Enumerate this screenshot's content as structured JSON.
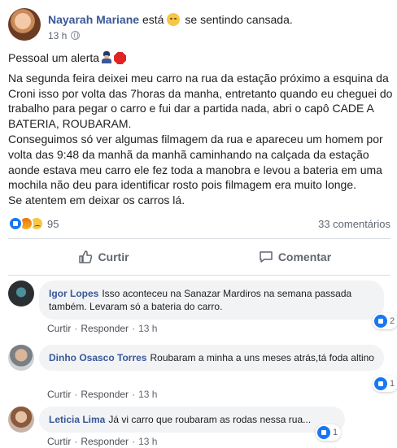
{
  "post": {
    "author": "Nayarah Mariane",
    "feeling_prefix": "está",
    "feeling_text": "se sentindo cansada.",
    "time": "13 h",
    "body": {
      "alert": "Pessoal um alerta",
      "paragraph1": "Na segunda feira deixei meu carro na rua da estação próximo a esquina da Croni isso por volta das 7horas da manha, entretanto quando eu cheguei do trabalho para pegar o carro e fui dar a partida nada, abri o capô CADE A BATERIA, ROUBARAM.",
      "paragraph2": "Conseguimos só ver algumas filmagem da rua e apareceu um homem por volta das 9:48 da manhã da manhã caminhando na calçada da estação aonde estava meu carro ele fez toda a manobra e levou a bateria em uma mochila não deu para identificar rosto pois filmagem era muito longe.",
      "paragraph3": "Se atentem em deixar os carros lá."
    },
    "reactions_count": "95",
    "comments_count": "33 comentários",
    "like_label": "Curtir",
    "comment_label": "Comentar"
  },
  "comments": [
    {
      "name": "Igor Lopes",
      "text": "Isso aconteceu na Sanazar Mardiros na semana passada também. Levaram só a bateria do carro.",
      "like_action": "Curtir",
      "reply_action": "Responder",
      "time": "13 h",
      "likes": "2"
    },
    {
      "name": "Dinho Osasco Torres",
      "text": "Roubaram a minha a uns meses atrás,tá foda altino",
      "like_action": "Curtir",
      "reply_action": "Responder",
      "time": "13 h",
      "likes": "1"
    },
    {
      "name": "Leticia Lima",
      "text": "Já vi carro que roubaram as rodas nessa rua...",
      "like_action": "Curtir",
      "reply_action": "Responder",
      "time": "13 h",
      "likes": "1"
    }
  ],
  "colors": {
    "link_blue": "#385898",
    "like_blue": "#1877f2",
    "bubble_gray": "#f2f3f5",
    "meta_gray": "#606770"
  }
}
